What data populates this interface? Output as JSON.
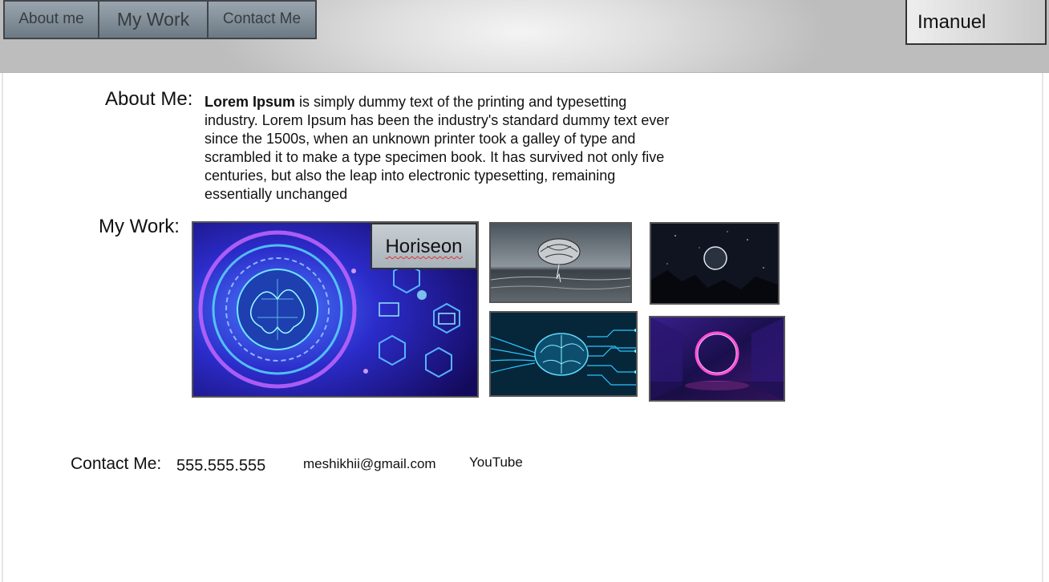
{
  "header": {
    "nav": [
      {
        "label": "About me"
      },
      {
        "label": "My Work"
      },
      {
        "label": "Contact Me"
      }
    ],
    "brand": "Imanuel"
  },
  "about": {
    "heading": "About Me:",
    "bold_lead": "Lorem Ipsum",
    "text": " is simply dummy text of the printing and typesetting industry. Lorem Ipsum has been the industry's standard dummy text ever since the 1500s, when an unknown printer took a galley of type and scrambled it to make a type specimen book. It has survived not only five centuries, but also the leap into electronic typesetting, remaining essentially unchanged"
  },
  "work": {
    "heading": "My Work:",
    "featured_label": "Horiseon",
    "colors": {
      "tile_border": "#555555",
      "label_bg": "#b8c0c6"
    }
  },
  "contact": {
    "heading": "Contact Me:",
    "phone": "555.555.555",
    "email": "meshikhii@gmail.com",
    "youtube": "YouTube"
  },
  "colors": {
    "nav_tab": "#7f8b95",
    "text": "#111111",
    "background": "#ffffff"
  }
}
